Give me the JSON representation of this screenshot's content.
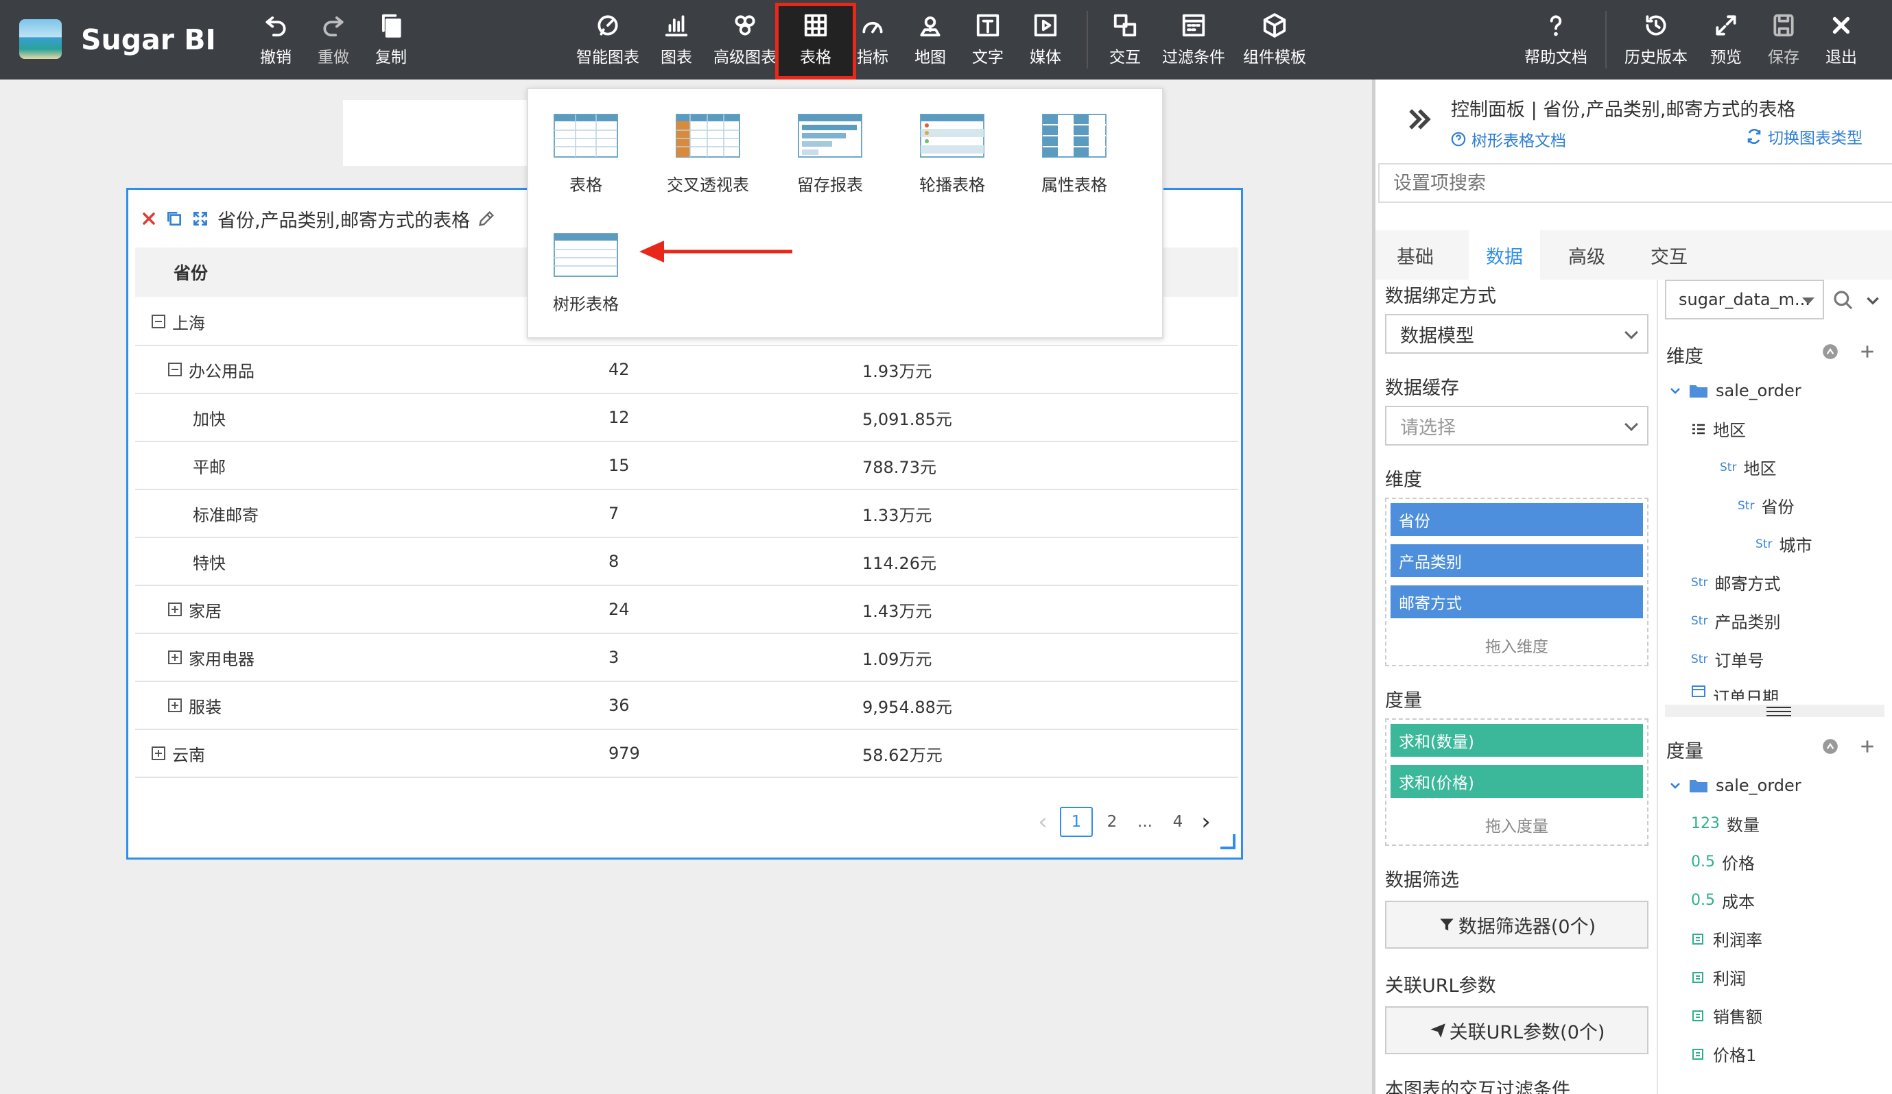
{
  "app": {
    "title": "Sugar BI"
  },
  "toolbar": {
    "left": [
      {
        "label": "撤销",
        "icon": "undo-icon"
      },
      {
        "label": "重做",
        "icon": "redo-icon"
      },
      {
        "label": "复制",
        "icon": "copy-icon"
      }
    ],
    "center": [
      {
        "label": "智能图表",
        "icon": "smart-chart-icon"
      },
      {
        "label": "图表",
        "icon": "bar-chart-icon"
      },
      {
        "label": "高级图表",
        "icon": "advanced-chart-icon"
      },
      {
        "label": "表格",
        "icon": "table-icon"
      },
      {
        "label": "指标",
        "icon": "gauge-icon"
      },
      {
        "label": "地图",
        "icon": "map-pin-icon"
      },
      {
        "label": "文字",
        "icon": "text-icon"
      },
      {
        "label": "媒体",
        "icon": "media-icon"
      },
      {
        "label": "交互",
        "icon": "interaction-icon"
      },
      {
        "label": "过滤条件",
        "icon": "filter-icon"
      },
      {
        "label": "组件模板",
        "icon": "component-template-icon"
      }
    ],
    "right": [
      {
        "label": "帮助文档",
        "icon": "help-icon"
      },
      {
        "label": "历史版本",
        "icon": "history-icon"
      },
      {
        "label": "预览",
        "icon": "preview-icon"
      },
      {
        "label": "保存",
        "icon": "save-icon"
      },
      {
        "label": "退出",
        "icon": "close-icon"
      }
    ]
  },
  "popup": {
    "items": [
      {
        "label": "表格"
      },
      {
        "label": "交叉透视表"
      },
      {
        "label": "留存报表"
      },
      {
        "label": "轮播表格"
      },
      {
        "label": "属性表格"
      },
      {
        "label": "树形表格"
      }
    ]
  },
  "chart": {
    "title": "省份,产品类别,邮寄方式的表格",
    "header": {
      "col1": "省份"
    },
    "rows": [
      {
        "name": "上海",
        "count": "",
        "value": "",
        "level": 0,
        "toggle": "minus"
      },
      {
        "name": "办公用品",
        "count": "42",
        "value": "1.93万元",
        "level": 1,
        "toggle": "minus"
      },
      {
        "name": "加快",
        "count": "12",
        "value": "5,091.85元",
        "level": 2,
        "toggle": ""
      },
      {
        "name": "平邮",
        "count": "15",
        "value": "788.73元",
        "level": 2,
        "toggle": ""
      },
      {
        "name": "标准邮寄",
        "count": "7",
        "value": "1.33万元",
        "level": 2,
        "toggle": ""
      },
      {
        "name": "特快",
        "count": "8",
        "value": "114.26元",
        "level": 2,
        "toggle": ""
      },
      {
        "name": "家居",
        "count": "24",
        "value": "1.43万元",
        "level": 1,
        "toggle": "plus"
      },
      {
        "name": "家用电器",
        "count": "3",
        "value": "1.09万元",
        "level": 1,
        "toggle": "plus"
      },
      {
        "name": "服装",
        "count": "36",
        "value": "9,954.88元",
        "level": 1,
        "toggle": "plus"
      },
      {
        "name": "云南",
        "count": "979",
        "value": "58.62万元",
        "level": 0,
        "toggle": "plus"
      }
    ],
    "pagination": {
      "prev": "‹",
      "pages": [
        "1",
        "2",
        "...",
        "4"
      ],
      "current": "1",
      "next": "›"
    }
  },
  "panel": {
    "title": "控制面板 | 省份,产品类别,邮寄方式的表格",
    "doc_link": "树形表格文档",
    "switch_link": "切换图表类型",
    "search_placeholder": "设置项搜索",
    "tabs": [
      {
        "label": "基础"
      },
      {
        "label": "数据"
      },
      {
        "label": "高级"
      },
      {
        "label": "交互"
      }
    ],
    "active_tab": "数据",
    "binding_label": "数据绑定方式",
    "binding_value": "数据模型",
    "cache_label": "数据缓存",
    "cache_placeholder": "请选择",
    "dim_label": "维度",
    "dims": [
      "省份",
      "产品类别",
      "邮寄方式"
    ],
    "dim_hint": "拖入维度",
    "measure_label": "度量",
    "measures": [
      "求和(数量)",
      "求和(价格)"
    ],
    "measure_hint": "拖入度量",
    "filter_label": "数据筛选",
    "filter_btn": "数据筛选器(0个)",
    "url_label": "关联URL参数",
    "url_btn": "关联URL参数(0个)",
    "cut_label": "本图表的交互过滤条件"
  },
  "model": {
    "select": "sugar_data_m...",
    "dim_title": "维度",
    "dim_folder": "sale_order",
    "dim_fields": [
      {
        "label": "地区",
        "tag": "",
        "indent": 0
      },
      {
        "label": "地区",
        "tag": "Str",
        "indent": 1
      },
      {
        "label": "省份",
        "tag": "Str",
        "indent": 2
      },
      {
        "label": "城市",
        "tag": "Str",
        "indent": 3
      },
      {
        "label": "邮寄方式",
        "tag": "Str",
        "indent": 0
      },
      {
        "label": "产品类别",
        "tag": "Str",
        "indent": 0
      },
      {
        "label": "订单号",
        "tag": "Str",
        "indent": 0
      },
      {
        "label": "订单日期",
        "tag": "",
        "indent": 0
      }
    ],
    "measure_title": "度量",
    "measure_folder": "sale_order",
    "measure_fields": [
      {
        "label": "数量",
        "tag": "123"
      },
      {
        "label": "价格",
        "tag": "0.5"
      },
      {
        "label": "成本",
        "tag": "0.5"
      },
      {
        "label": "利润率",
        "tag": ""
      },
      {
        "label": "利润",
        "tag": ""
      },
      {
        "label": "销售额",
        "tag": ""
      },
      {
        "label": "价格1",
        "tag": ""
      }
    ]
  },
  "colors": {
    "topbar": "#3c3f44",
    "accent": "#2e8df0",
    "highlight": "#e8281a",
    "dim_pill": "#4d8fdc",
    "measure_pill": "#3bb89a"
  }
}
